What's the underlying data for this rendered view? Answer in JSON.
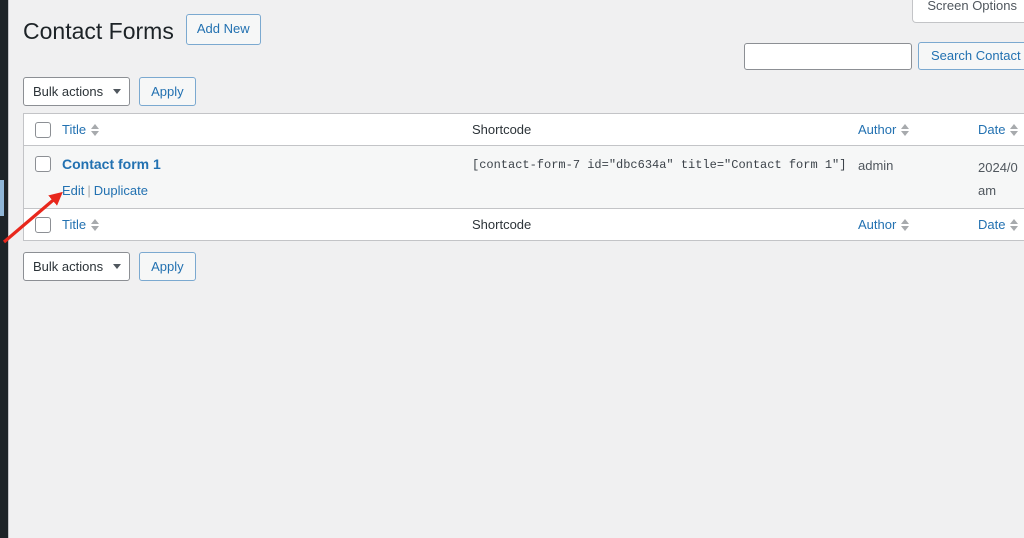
{
  "screen_meta": {
    "screen_options_label": "Screen Options"
  },
  "header": {
    "page_title": "Contact Forms",
    "add_new_label": "Add New"
  },
  "search": {
    "value": "",
    "placeholder": "",
    "submit_label": "Search Contact Forms"
  },
  "tablenav_top": {
    "bulk_actions_label": "Bulk actions",
    "apply_label": "Apply"
  },
  "tablenav_bottom": {
    "bulk_actions_label": "Bulk actions",
    "apply_label": "Apply"
  },
  "table": {
    "columns": {
      "title": "Title",
      "shortcode": "Shortcode",
      "author": "Author",
      "date": "Date"
    },
    "rows": [
      {
        "title": "Contact form 1",
        "actions": {
          "edit": "Edit",
          "separator": "|",
          "duplicate": "Duplicate"
        },
        "shortcode": "[contact-form-7 id=\"dbc634a\" title=\"Contact form 1\"]",
        "author": "admin",
        "date_line1": "2024/0",
        "date_line2": "am"
      }
    ]
  },
  "colors": {
    "link": "#2271b1",
    "page_background": "#f0f0f1",
    "row_background": "#f6f7f7",
    "border": "#c3c4c7",
    "annotation_arrow": "#e8271c",
    "admin_rail": "#1d2327"
  }
}
